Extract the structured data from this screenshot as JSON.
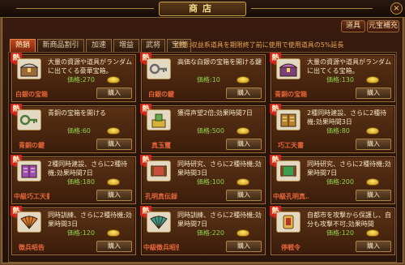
{
  "window": {
    "title": "商店",
    "close_label": "×"
  },
  "top_buttons": {
    "items_label": "道具",
    "recharge_label": "元宝補充"
  },
  "tabs": [
    "熱銷",
    "新商品割引",
    "加速",
    "増益",
    "武将",
    "宝物"
  ],
  "notice": "注意:収益系道具を期限終了前に使用で使用道具の5%延長",
  "buy_label": "購入",
  "items": [
    {
      "name": "白銀の宝箱",
      "desc": "大量の資源や道具がランダムに出てくる豪華宝箱。",
      "price": "価格:270",
      "hot": "熱",
      "icon": "silver-chest-icon"
    },
    {
      "name": "白銀の鍵",
      "desc": "高価な白銀の宝箱を開ける鍵",
      "price": "価格:10",
      "hot": "熱",
      "icon": "silver-key-icon"
    },
    {
      "name": "青銅の宝箱",
      "desc": "大量の資源や道具がランダムに出てくる宝箱。",
      "price": "価格:130",
      "hot": "熱",
      "icon": "bronze-chest-icon"
    },
    {
      "name": "青銅の鍵",
      "desc": "青銅の宝箱を開ける",
      "price": "価格:60",
      "hot": "熱",
      "icon": "bronze-key-icon"
    },
    {
      "name": "真玉璽",
      "desc": "獲得声望2倍;効果時間7日",
      "price": "価格:500",
      "hot": "熱",
      "icon": "jade-seal-icon"
    },
    {
      "name": "巧工天書",
      "desc": "2種同時建設、さらに2種待機;効果時間3日",
      "price": "価格:80",
      "hot": "熱",
      "icon": "craft-book-icon"
    },
    {
      "name": "中級巧工天書",
      "desc": "2種同時建設、さらに2種待機;効果時間7日",
      "price": "価格:180",
      "hot": "熱",
      "icon": "mid-craft-book-icon"
    },
    {
      "name": "孔明真伝録",
      "desc": "同時研究、さらに2種待機;効果時間3日",
      "price": "価格:100",
      "hot": "熱",
      "icon": "kongming-scroll-icon"
    },
    {
      "name": "中級孔明真…",
      "desc": "同時研究、さらに2種待機;効果時間7日",
      "price": "価格:200",
      "hot": "熱",
      "icon": "mid-kongming-scroll-icon"
    },
    {
      "name": "徴兵昭告",
      "desc": "同時訓練、さらに2種待機;効果時間3日",
      "price": "価格:120",
      "hot": "熱",
      "icon": "conscription-icon"
    },
    {
      "name": "中級徴兵昭告",
      "desc": "同時訓練、さらに2種待機;効果時間7日",
      "price": "価格:220",
      "hot": "熱",
      "icon": "mid-conscription-icon"
    },
    {
      "name": "停戦令",
      "desc": "自都市を攻撃から保護し、自分も攻撃不可;効果時間",
      "price": "価格:120",
      "hot": "熱",
      "icon": "ceasefire-icon"
    }
  ],
  "colors": {
    "accent": "#c1481f",
    "price": "#8fd04a",
    "name": "#e6663a",
    "hot": "#d4241c"
  }
}
